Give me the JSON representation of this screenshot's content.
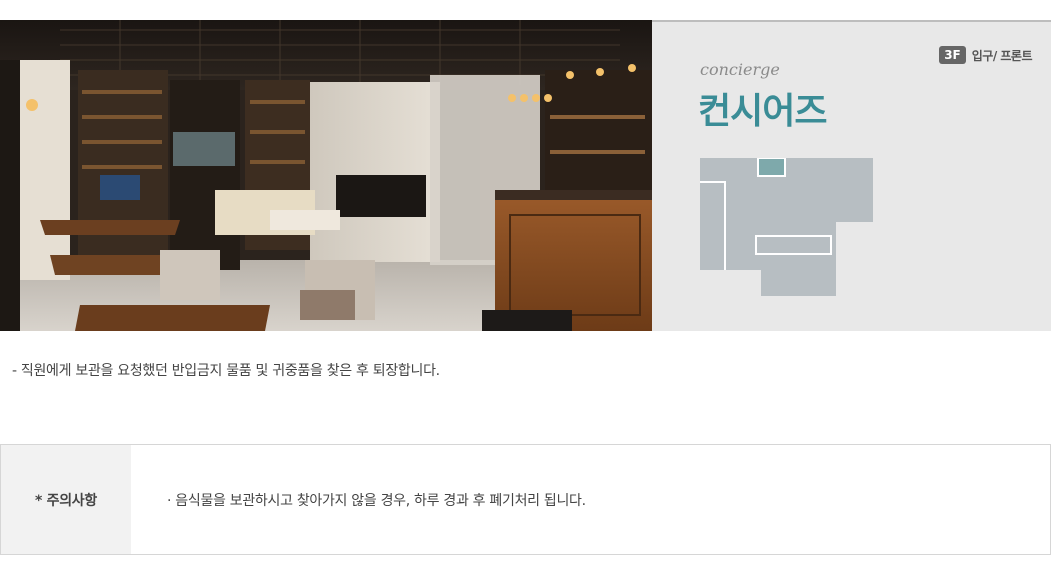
{
  "info": {
    "floor_badge": "3F",
    "floor_location": "입구/ 프론트",
    "subtitle": "concierge",
    "title": "컨시어즈",
    "map_colors": {
      "area": "#b7bec2",
      "highlight": "#7ea9ab",
      "outline": "#ffffff"
    },
    "accent_color": "#3a8c96"
  },
  "description": "-  직원에게 보관을 요청했던 반입금지 물품 및 귀중품을 찾은 후 퇴장합니다.",
  "notice": {
    "label": "* 주의사항",
    "text": "· 음식물을 보관하시고 찾아가지 않을 경우, 하루 경과 후 폐기처리 됩니다."
  }
}
